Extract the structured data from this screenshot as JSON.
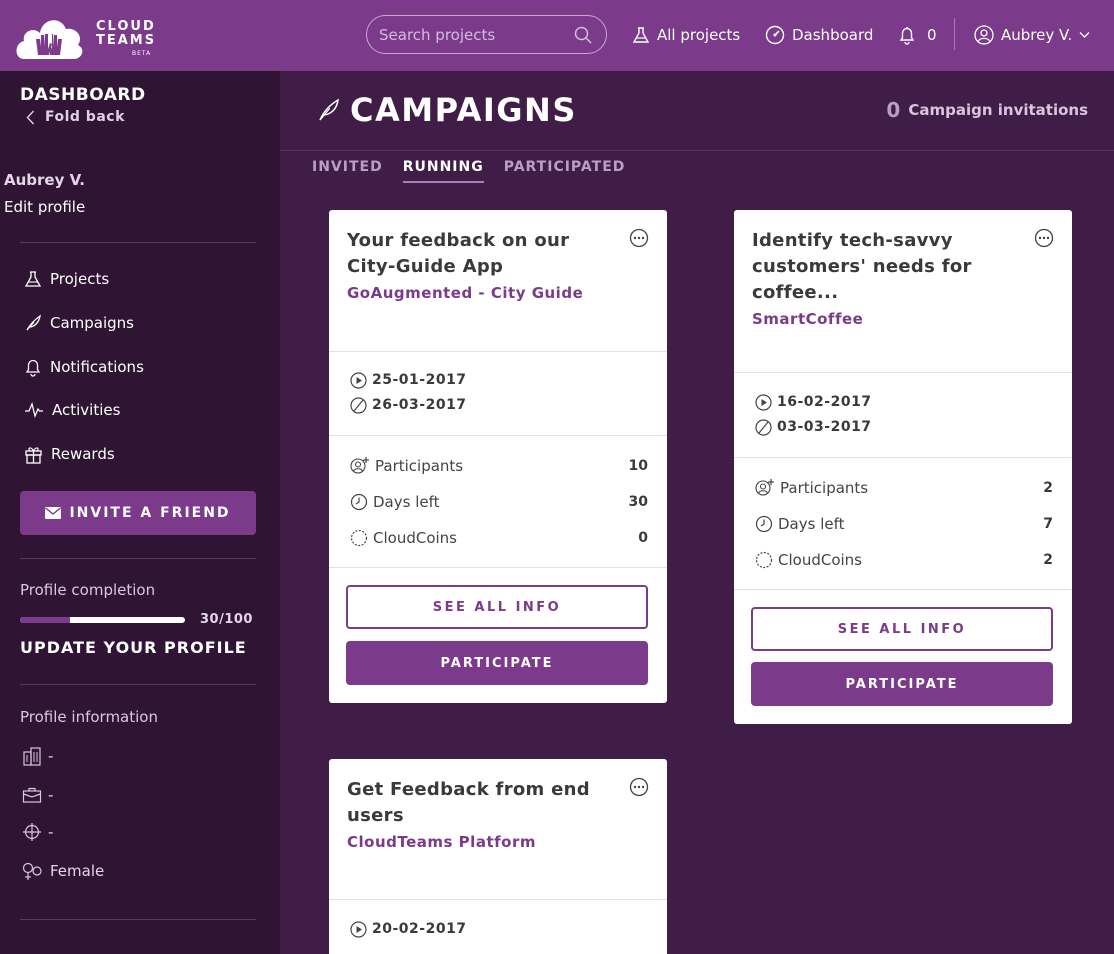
{
  "brand": {
    "line1": "CLOUD",
    "line2": "TEAMS",
    "badge": "BETA"
  },
  "search": {
    "placeholder": "Search projects"
  },
  "topnav": {
    "all_projects": "All projects",
    "dashboard": "Dashboard",
    "notifications_count": "0",
    "user": "Aubrey V."
  },
  "sidebar": {
    "title": "DASHBOARD",
    "fold_back": "Fold back",
    "user_name": "Aubrey V.",
    "edit_profile": "Edit profile",
    "menu": {
      "projects": "Projects",
      "campaigns": "Campaigns",
      "notifications": "Notifications",
      "activities": "Activities",
      "rewards": "Rewards"
    },
    "invite_label": "INVITE A FRIEND",
    "profile_completion_label": "Profile completion",
    "profile_completion_value": "30/100",
    "profile_completion_fraction": 0.3,
    "update_profile": "UPDATE YOUR PROFILE",
    "profile_info_label": "Profile information",
    "profile_info": {
      "company": "-",
      "job": "-",
      "location": "-",
      "gender": "Female"
    }
  },
  "main": {
    "title": "CAMPAIGNS",
    "invitations_count": "0",
    "invitations_label": "Campaign invitations",
    "tabs": {
      "invited": "INVITED",
      "running": "RUNNING",
      "participated": "PARTICIPATED"
    }
  },
  "labels": {
    "participants": "Participants",
    "days_left": "Days left",
    "cloudcoins": "CloudCoins",
    "see_all_info": "SEE ALL INFO",
    "participate": "PARTICIPATE"
  },
  "campaigns": [
    {
      "title": "Your feedback on our City-Guide App",
      "project": "GoAugmented - City Guide",
      "start": "25-01-2017",
      "end": "26-03-2017",
      "participants": "10",
      "days_left": "30",
      "cloudcoins": "0"
    },
    {
      "title": "Identify tech-savvy customers' needs for coffee...",
      "project": "SmartCoffee",
      "start": "16-02-2017",
      "end": "03-03-2017",
      "participants": "2",
      "days_left": "7",
      "cloudcoins": "2"
    },
    {
      "title": "Get Feedback from end users",
      "project": "CloudTeams Platform",
      "start": "20-02-2017"
    }
  ]
}
